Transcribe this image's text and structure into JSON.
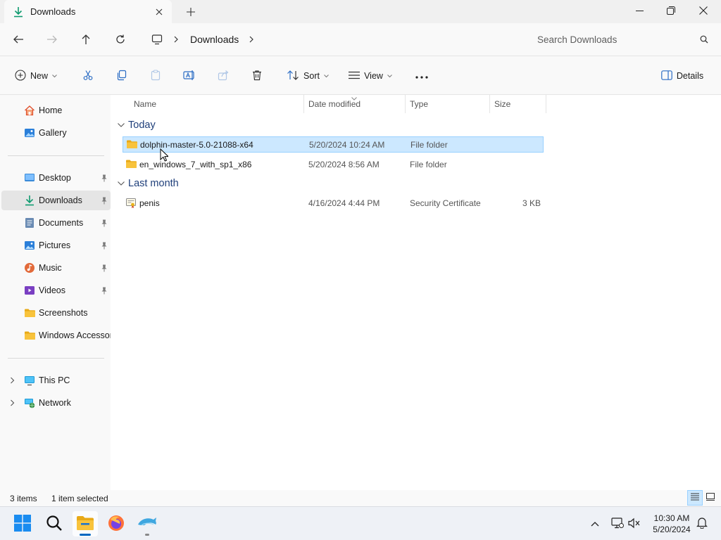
{
  "window": {
    "tab_title": "Downloads",
    "colors": {
      "accent": "#0067c0",
      "selection": "#cce8ff",
      "folder": "#f8c33c",
      "group_header": "#1f3f7a"
    }
  },
  "nav": {
    "breadcrumb": [
      "Downloads"
    ],
    "search_placeholder": "Search Downloads"
  },
  "commands": {
    "new": "New",
    "sort": "Sort",
    "view": "View",
    "details": "Details"
  },
  "sidebar": {
    "top": [
      {
        "label": "Home",
        "icon": "home-icon"
      },
      {
        "label": "Gallery",
        "icon": "gallery-icon"
      }
    ],
    "pinned": [
      {
        "label": "Desktop",
        "icon": "desktop-icon",
        "pinned": true
      },
      {
        "label": "Downloads",
        "icon": "downloads-icon",
        "pinned": true,
        "selected": true
      },
      {
        "label": "Documents",
        "icon": "documents-icon",
        "pinned": true
      },
      {
        "label": "Pictures",
        "icon": "pictures-icon",
        "pinned": true
      },
      {
        "label": "Music",
        "icon": "music-icon",
        "pinned": true
      },
      {
        "label": "Videos",
        "icon": "videos-icon",
        "pinned": true
      },
      {
        "label": "Screenshots",
        "icon": "folder-icon",
        "pinned": false
      },
      {
        "label": "Windows Accessories",
        "icon": "folder-icon",
        "pinned": false
      }
    ],
    "devices": [
      {
        "label": "This PC",
        "icon": "this-pc-icon"
      },
      {
        "label": "Network",
        "icon": "network-icon"
      }
    ]
  },
  "columns": {
    "name": "Name",
    "date": "Date modified",
    "type": "Type",
    "size": "Size"
  },
  "groups": [
    {
      "title": "Today",
      "files": [
        {
          "name": "dolphin-master-5.0-21088-x64",
          "date": "5/20/2024 10:24 AM",
          "type": "File folder",
          "size": "",
          "selected": true,
          "icon": "folder-icon"
        },
        {
          "name": "en_windows_7_with_sp1_x86",
          "date": "5/20/2024 8:56 AM",
          "type": "File folder",
          "size": "",
          "selected": false,
          "icon": "folder-icon"
        }
      ]
    },
    {
      "title": "Last month",
      "files": [
        {
          "name": "penis",
          "date": "4/16/2024 4:44 PM",
          "type": "Security Certificate",
          "size": "3 KB",
          "selected": false,
          "icon": "certificate-icon"
        }
      ]
    }
  ],
  "status": {
    "item_count": "3 items",
    "selection": "1 item selected"
  },
  "taskbar": {
    "apps": [
      "start-icon",
      "search-icon",
      "file-explorer-icon",
      "firefox-icon",
      "dolphin-icon"
    ],
    "time": "10:30 AM",
    "date": "5/20/2024"
  }
}
